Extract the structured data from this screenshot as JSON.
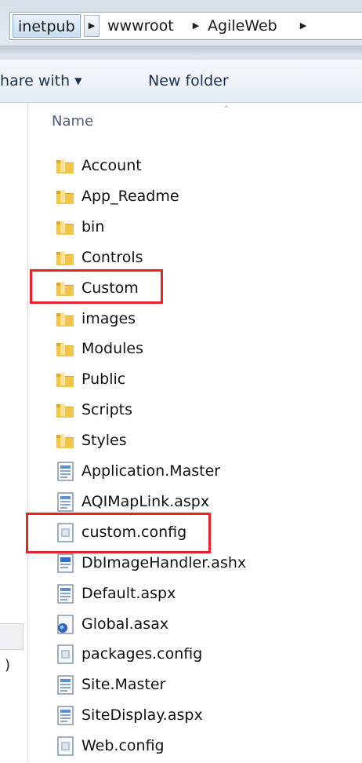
{
  "breadcrumb": {
    "items": [
      "inetpub",
      "wwwroot",
      "AgileWeb"
    ],
    "separator_glyph": "▶"
  },
  "toolbar": {
    "share_label": "Share with",
    "share_arrow": "▼",
    "new_folder_label": "New folder"
  },
  "columns": {
    "name_header": "Name",
    "sort_glyph": "˄"
  },
  "nav": {
    "partial_text": ")"
  },
  "files": [
    {
      "name": "Account",
      "icon": "folder-icon"
    },
    {
      "name": "App_Readme",
      "icon": "folder-icon"
    },
    {
      "name": "bin",
      "icon": "folder-icon"
    },
    {
      "name": "Controls",
      "icon": "folder-icon"
    },
    {
      "name": "Custom",
      "icon": "folder-icon",
      "highlighted": true
    },
    {
      "name": "images",
      "icon": "folder-icon"
    },
    {
      "name": "Modules",
      "icon": "folder-icon"
    },
    {
      "name": "Public",
      "icon": "folder-icon"
    },
    {
      "name": "Scripts",
      "icon": "folder-icon"
    },
    {
      "name": "Styles",
      "icon": "folder-icon"
    },
    {
      "name": "Application.Master",
      "icon": "web-file-icon"
    },
    {
      "name": "AQIMapLink.aspx",
      "icon": "web-file-icon"
    },
    {
      "name": "custom.config",
      "icon": "config-file-icon",
      "highlighted": true
    },
    {
      "name": "DbImageHandler.ashx",
      "icon": "handler-file-icon"
    },
    {
      "name": "Default.aspx",
      "icon": "web-file-icon"
    },
    {
      "name": "Global.asax",
      "icon": "asax-file-icon"
    },
    {
      "name": "packages.config",
      "icon": "config-file-icon"
    },
    {
      "name": "Site.Master",
      "icon": "web-file-icon"
    },
    {
      "name": "SiteDisplay.aspx",
      "icon": "web-file-icon"
    },
    {
      "name": "Web.config",
      "icon": "config-file-icon"
    }
  ],
  "colors": {
    "highlight": "#e8232a",
    "folder": "#e8b83a"
  }
}
